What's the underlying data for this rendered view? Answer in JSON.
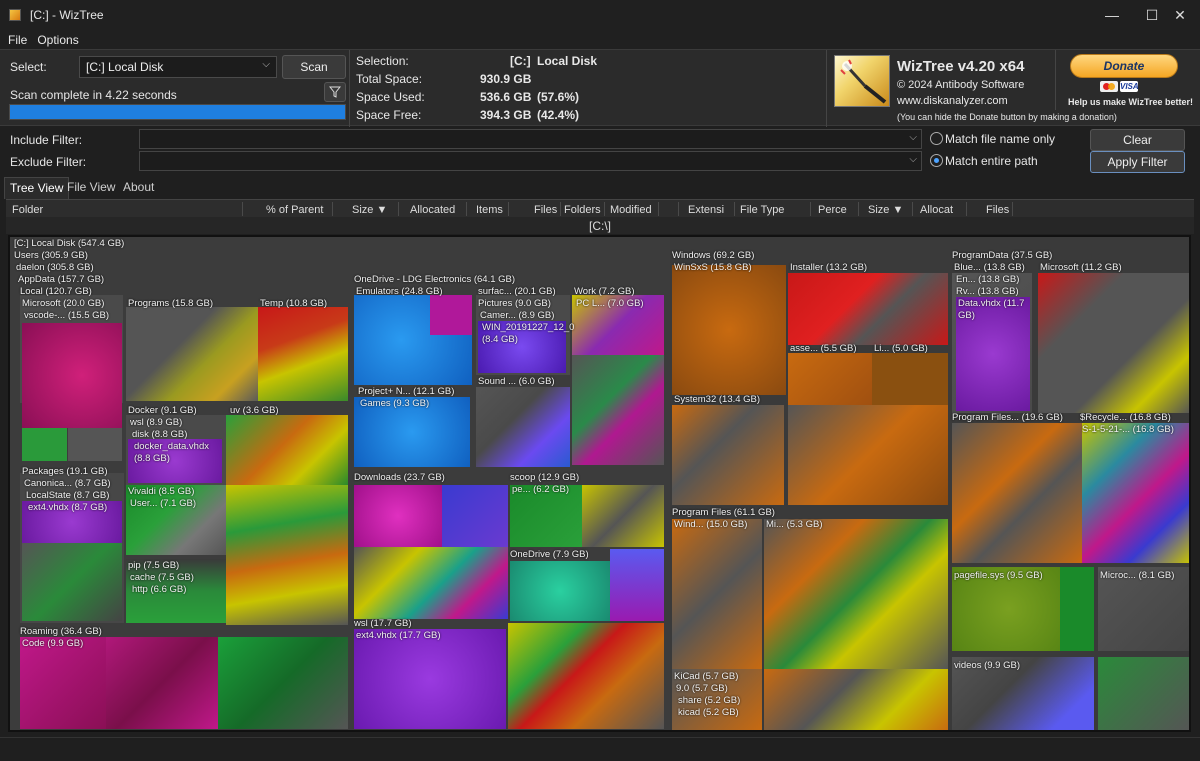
{
  "window": {
    "title": "[C:]  - WizTree",
    "min": "—",
    "max": "☐",
    "close": "✕"
  },
  "menu": [
    "File",
    "Options"
  ],
  "scan": {
    "select_label": "Select:",
    "drive": "[C:] Local Disk",
    "scan_button": "Scan",
    "status": "Scan complete in 4.22 seconds",
    "progress": 1.0
  },
  "info": {
    "selection_label": "Selection:",
    "selection_drive": "[C:]",
    "selection_name": "Local Disk",
    "total_label": "Total Space:",
    "total_value": "930.9 GB",
    "used_label": "Space Used:",
    "used_value": "536.6 GB",
    "used_pct": "(57.6%)",
    "free_label": "Space Free:",
    "free_value": "394.3 GB",
    "free_pct": "(42.4%)"
  },
  "brand": {
    "name": "WizTree v4.20 x64",
    "copyright": "© 2024 Antibody Software",
    "url": "www.diskanalyzer.com",
    "note": "(You can hide the Donate button by making a donation)",
    "donate": "Donate",
    "donate_caption": "Help us make WizTree better!",
    "card1": "mastercard",
    "card2": "VISA"
  },
  "filters": {
    "include_label": "Include Filter:",
    "exclude_label": "Exclude Filter:",
    "match_name": "Match file name only",
    "match_path": "Match entire path",
    "clear": "Clear",
    "apply": "Apply Filter"
  },
  "tabs": [
    "Tree View",
    "File View",
    "About"
  ],
  "columns": [
    "Folder",
    "% of Parent",
    "Size ▼",
    "Allocated",
    "Items",
    "Files",
    "Folders",
    "Modified",
    "",
    "Extensi",
    "File Type",
    "Perce",
    "Size ▼",
    "Allocat",
    "Files"
  ],
  "path": "[C:\\]",
  "treemap_labels": {
    "root": "[C:] Local Disk  (547.4 GB)",
    "users": "Users  (305.9 GB)",
    "daelon": "daelon  (305.8 GB)",
    "appdata": "AppData  (157.7 GB)",
    "local": "Local  (120.7 GB)",
    "microsoft": "Microsoft  (20.0 GB)",
    "vscode": "vscode-...  (15.5 GB)",
    "programs": "Programs  (15.8 GB)",
    "temp": "Temp  (10.8 GB)",
    "docker": "Docker  (9.1 GB)",
    "wsl1": "wsl  (8.9 GB)",
    "disk": "disk  (8.8 GB)",
    "dockervhdx": "docker_data.vhdx",
    "dockervhdx_size": "(8.8 GB)",
    "uv": "uv  (3.6 GB)",
    "packages": "Packages  (19.1 GB)",
    "canonical": "Canonica...  (8.7 GB)",
    "localstate": "LocalState  (8.7 GB)",
    "ext4a": "ext4.vhdx  (8.7 GB)",
    "vivaldi": "Vivaldi  (8.5 GB)",
    "user": "User...  (7.1 GB)",
    "pip": "pip  (7.5 GB)",
    "cache": "cache  (7.5 GB)",
    "http": "http  (6.6 GB)",
    "roaming": "Roaming  (36.4 GB)",
    "code": "Code  (9.9 GB)",
    "onedrive_ldg": "OneDrive - LDG Electronics  (64.1 GB)",
    "emulators": "Emulators  (24.8 GB)",
    "surface": "surfac...  (20.1 GB)",
    "pictures": "Pictures  (9.0 GB)",
    "camera": "Camer...  (8.9 GB)",
    "win2019": "WIN_20191227_12_0",
    "win2019_size": "(8.4 GB)",
    "sound": "Sound ...  (6.0 GB)",
    "work": "Work  (7.2 GB)",
    "pcl": "PC L...  (7.0 GB)",
    "project": "Project+ N...  (12.1 GB)",
    "games": "Games  (9.3 GB)",
    "downloads": "Downloads  (23.7 GB)",
    "scoop": "scoop  (12.9 GB)",
    "pe": "pe...  (6.2 GB)",
    "onedrive": "OneDrive  (7.9 GB)",
    "wsl2": "wsl  (17.7 GB)",
    "ext4b": "ext4.vhdx  (17.7 GB)",
    "windows": "Windows  (69.2 GB)",
    "winsxs": "WinSxS  (15.8 GB)",
    "installer": "Installer  (13.2 GB)",
    "asse": "asse...  (5.5 GB)",
    "li": "Li...  (5.0 GB)",
    "system32": "System32  (13.4 GB)",
    "programfiles": "Program Files  (61.1 GB)",
    "wind": "Wind...  (15.0 GB)",
    "mi": "Mi...  (5.3 GB)",
    "kicad": "KiCad  (5.7 GB)",
    "k90": "9.0  (5.7 GB)",
    "share": "share  (5.2 GB)",
    "kicad2": "kicad  (5.2 GB)",
    "programdata": "ProgramData  (37.5 GB)",
    "blue": "Blue...  (13.8 GB)",
    "en": "En...  (13.8 GB)",
    "rv": "Rv...  (13.8 GB)",
    "datavhdx": "Data.vhdx  (11.7",
    "datavhdx_size": "GB)",
    "msprog": "Microsoft  (11.2 GB)",
    "programfilesx": "Program Files...  (19.6 GB)",
    "recycle": "$Recycle...  (16.8 GB)",
    "s1521": "S-1-5-21-...  (16.8 GB)",
    "pagefile": "pagefile.sys  (9.5 GB)",
    "microc": "Microc...  (8.1 GB)",
    "videos": "videos  (9.9 GB)"
  },
  "colors": {
    "accent": "#1f7fe0",
    "magenta": "#c0188a",
    "blue": "#1e7fe0",
    "purple": "#7a2fe0",
    "green": "#1aa03a",
    "yellow": "#c8c400",
    "orange": "#d86a10",
    "red": "#e01818",
    "gray": "#5a5a5a",
    "teal": "#1aa08a",
    "olive": "#6a9a20"
  }
}
